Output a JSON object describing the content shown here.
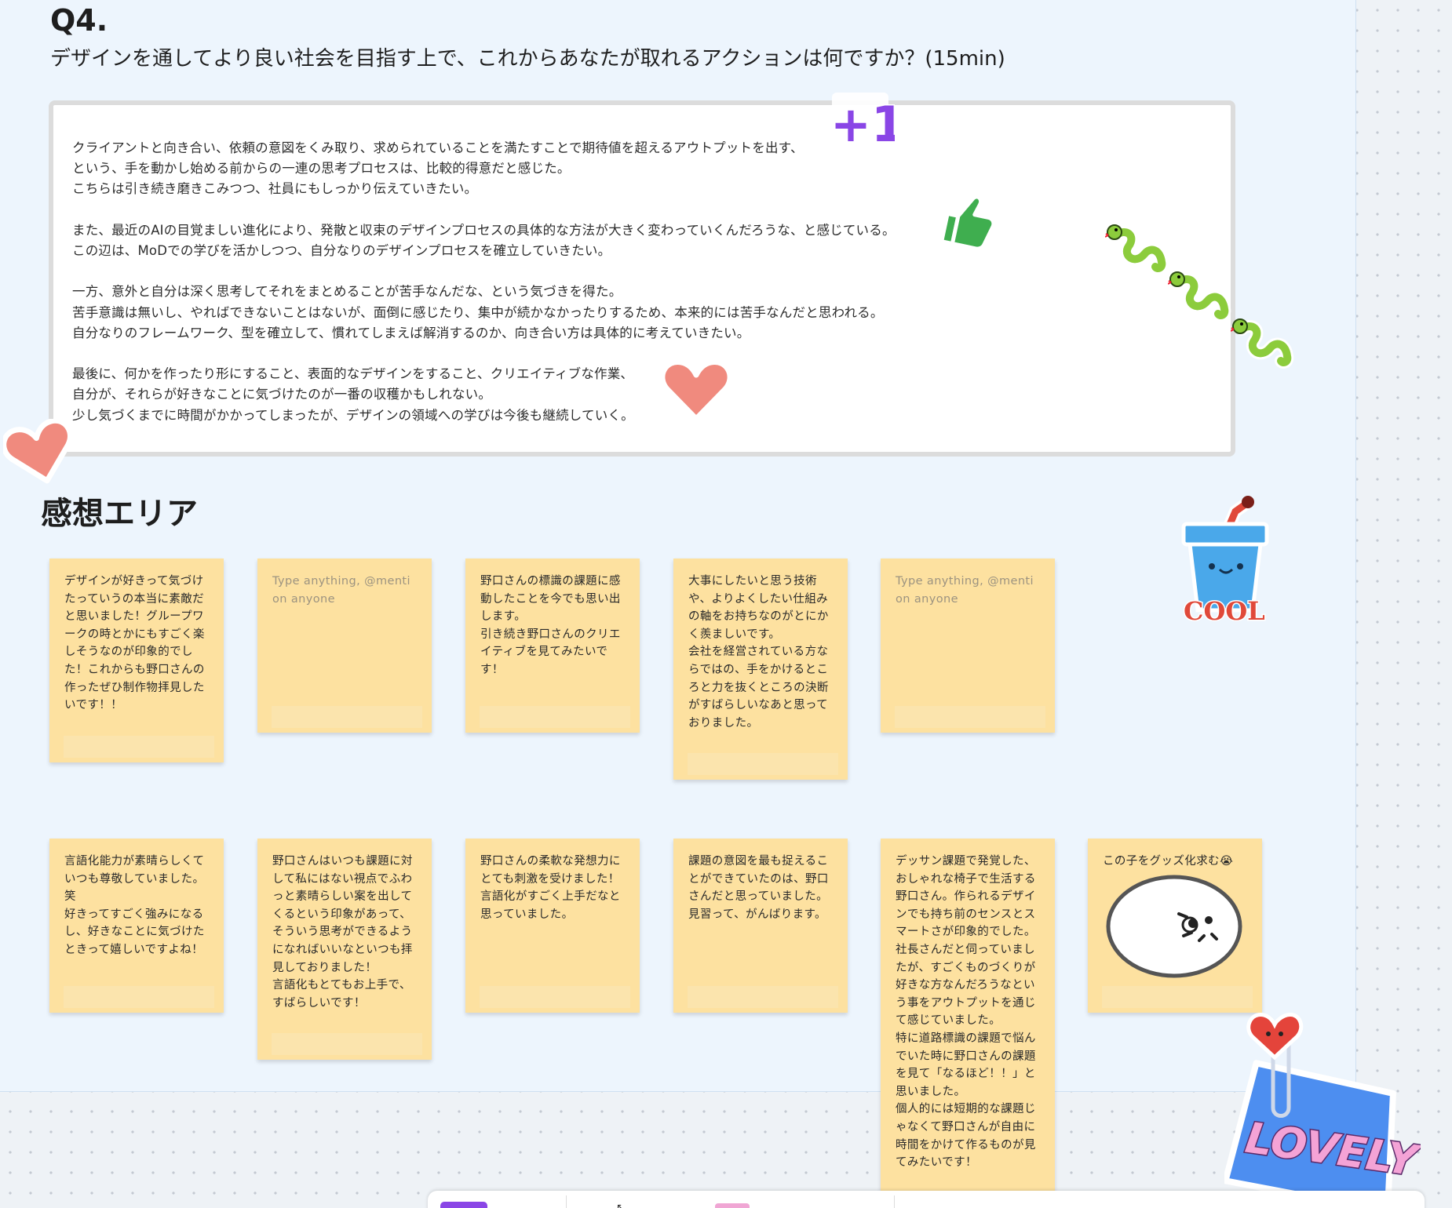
{
  "question": {
    "number": "Q4.",
    "text": "デザインを通してより良い社会を目指す上で、これからあなたが取れるアクションは何ですか？(15min)"
  },
  "answer": {
    "text": "クライアントと向き合い、依頼の意図をくみ取り、求められていることを満たすことで期待値を超えるアウトプットを出す、\nという、手を動かし始める前からの一連の思考プロセスは、比較的得意だと感じた。\nこちらは引き続き磨きこみつつ、社員にもしっかり伝えていきたい。\n\nまた、最近のAIの目覚ましい進化により、発散と収束のデザインプロセスの具体的な方法が大きく変わっていくんだろうな、と感じている。\nこの辺は、MoDでの学びを活かしつつ、自分なりのデザインプロセスを確立していきたい。\n\n一方、意外と自分は深く思考してそれをまとめることが苦手なんだな、という気づきを得た。\n苦手意識は無いし、やればできないことはないが、面倒に感じたり、集中が続かなかったりするため、本来的には苦手なんだと思われる。\n自分なりのフレームワーク、型を確立して、慣れてしまえば解消するのか、向き合い方は具体的に考えていきたい。\n\n最後に、何かを作ったり形にすること、表面的なデザインをすること、クリエイティブな作業、\n自分が、それらが好きなことに気づけたのが一番の収穫かもしれない。\n少し気づくまでに時間がかかってしまったが、デザインの領域への学びは今後も継続していく。"
  },
  "feedback_area": {
    "title": "感想エリア",
    "placeholder": "Type anything, @mention anyone",
    "notes": [
      {
        "text": "デザインが好きって気づけたっていうの本当に素敵だと思いました！グループワークの時とかにもすごく楽しそうなのが印象的でした！これからも野口さんの作ったぜひ制作物拝見したいです！！"
      },
      {
        "text": ""
      },
      {
        "text": "野口さんの標識の課題に感動したことを今でも思い出します。\n引き続き野口さんのクリエイティブを見てみたいです！"
      },
      {
        "text": "大事にしたいと思う技術や、よりよくしたい仕組みの軸をお持ちなのがとにかく羨ましいです。\n会社を経営されている方ならではの、手をかけるところと力を抜くところの決断がすばらしいなあと思っておりました。"
      },
      {
        "text": ""
      },
      {
        "text": "言語化能力が素晴らしくていつも尊敬していました。\n笑\n好きってすごく強みになるし、好きなことに気づけたときって嬉しいですよね！"
      },
      {
        "text": "野口さんはいつも課題に対して私にはない視点でふわっと素晴らしい案を出してくるという印象があって、そういう思考ができるようになればいいなといつも拝見しておりました！\n言語化もとてもお上手で、すばらしいです！"
      },
      {
        "text": "野口さんの柔軟な発想力にとても刺激を受けました！\n言語化がすごく上手だなと思っていました。"
      },
      {
        "text": "課題の意図を最も捉えることができていたのは、野口さんだと思っていました。\n見習って、がんばります。"
      },
      {
        "text": "デッサン課題で発覚した、おしゃれな椅子で生活する野口さん。作られるデザインでも持ち前のセンスとスマートさが印象的でした。\n社長さんだと伺っていましたが、すごくものづくりが好きな方なんだろうなという事をアウトプットを通じて感じていました。\n特に道路標識の課題で悩んでいた時に野口さんの課題を見て「なるほど！！」と思いました。\n個人的には短期的な課題じゃなくて野口さんが自由に時間をかけて作るものが見てみたいです！"
      },
      {
        "text": "この子をグッズ化求む😭"
      }
    ]
  },
  "stickers": {
    "plus_one": "+1",
    "cool": "COOL",
    "lovely": "LOVELY"
  },
  "colors": {
    "section_bg": "#edf5fd",
    "sticky_note": "#fde1a0",
    "heart": "#f08a7e",
    "thumb": "#3fae4f",
    "snake": "#8ccc3c",
    "plus_one": "#8a46e6"
  }
}
